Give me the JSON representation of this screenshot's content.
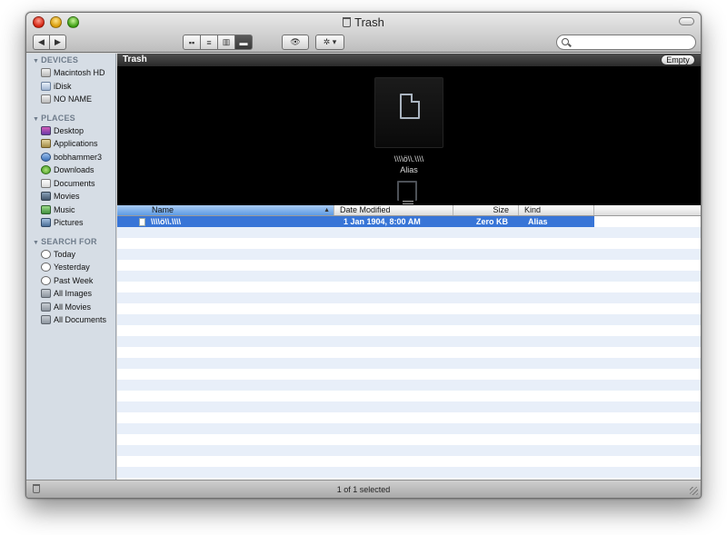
{
  "window": {
    "title": "Trash"
  },
  "toolbar": {
    "back_glyph": "◀",
    "forward_glyph": "▶",
    "view_icons": [
      "icon-view-icon",
      "list-view-icon",
      "column-view-icon",
      "coverflow-view-icon"
    ],
    "view_glyphs": [
      "▪▪",
      "≡",
      "▥",
      "▬"
    ],
    "quicklook_glyph": "👁",
    "action_glyph": "✲ ▾",
    "search": {
      "value": "",
      "placeholder": ""
    }
  },
  "sidebar": {
    "sections": [
      {
        "title": "DEVICES",
        "items": [
          {
            "label": "Macintosh HD",
            "icon": "disk"
          },
          {
            "label": "iDisk",
            "icon": "idisk"
          },
          {
            "label": "NO NAME",
            "icon": "disk"
          }
        ]
      },
      {
        "title": "PLACES",
        "items": [
          {
            "label": "Desktop",
            "icon": "desktop"
          },
          {
            "label": "Applications",
            "icon": "apps"
          },
          {
            "label": "bobhammer3",
            "icon": "home"
          },
          {
            "label": "Downloads",
            "icon": "downloads"
          },
          {
            "label": "Documents",
            "icon": "docs"
          },
          {
            "label": "Movies",
            "icon": "movies"
          },
          {
            "label": "Music",
            "icon": "music"
          },
          {
            "label": "Pictures",
            "icon": "pictures"
          }
        ]
      },
      {
        "title": "SEARCH FOR",
        "items": [
          {
            "label": "Today",
            "icon": "clock"
          },
          {
            "label": "Yesterday",
            "icon": "clock"
          },
          {
            "label": "Past Week",
            "icon": "clock"
          },
          {
            "label": "All Images",
            "icon": "folder"
          },
          {
            "label": "All Movies",
            "icon": "folder"
          },
          {
            "label": "All Documents",
            "icon": "folder"
          }
        ]
      }
    ]
  },
  "pathbar": {
    "label": "Trash",
    "empty_button": "Empty"
  },
  "coverflow": {
    "file_name": "\\\\\\\\ö\\\\.\\\\\\\\",
    "kind": "Alias"
  },
  "list": {
    "columns": {
      "name": "Name",
      "date": "Date Modified",
      "size": "Size",
      "kind": "Kind"
    },
    "sort_glyph": "▲",
    "rows": [
      {
        "name": "\\\\\\\\ö\\\\.\\\\\\\\",
        "date": "1 Jan 1904, 8:00 AM",
        "size": "Zero KB",
        "kind": "Alias",
        "selected": true
      }
    ]
  },
  "status": {
    "text": "1 of 1 selected"
  },
  "colors": {
    "selection": "#3875d7",
    "row_stripe": "#e8eff9",
    "sidebar_bg": "#d6dde5"
  }
}
